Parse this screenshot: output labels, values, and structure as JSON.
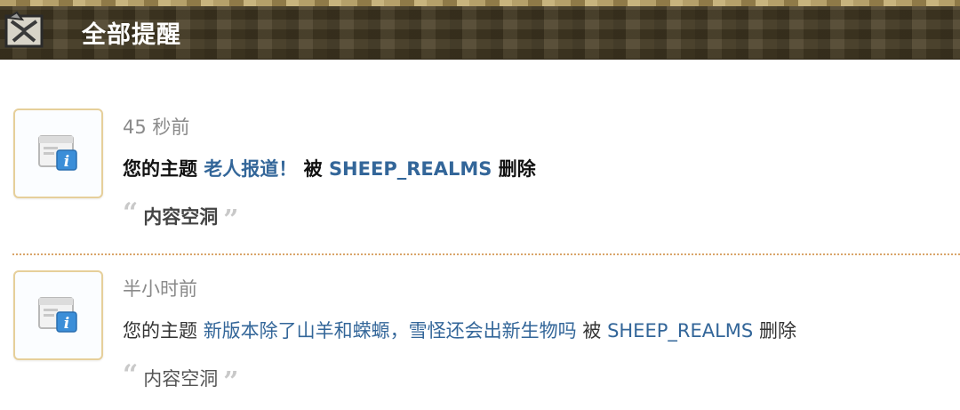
{
  "header": {
    "title": "全部提醒",
    "back_icon": "back-icon"
  },
  "notices": [
    {
      "time": "45 秒前",
      "prefix": "您的主题",
      "topic": "老人报道！",
      "middle": "被",
      "user": "SHEEP_REALMS",
      "suffix": "删除",
      "reason": "内容空洞",
      "icon": "notice-info-icon"
    },
    {
      "time": "半小时前",
      "prefix": "您的主题",
      "topic": "新版本除了山羊和蝾螈，雪怪还会出新生物吗",
      "middle": "被",
      "user": "SHEEP_REALMS",
      "suffix": "删除",
      "reason": "内容空洞",
      "icon": "notice-info-icon"
    }
  ],
  "colors": {
    "link": "#336699",
    "header_bg": "#4a3f27",
    "icon_border": "#e6cf9a",
    "divider": "#d9a56a"
  }
}
